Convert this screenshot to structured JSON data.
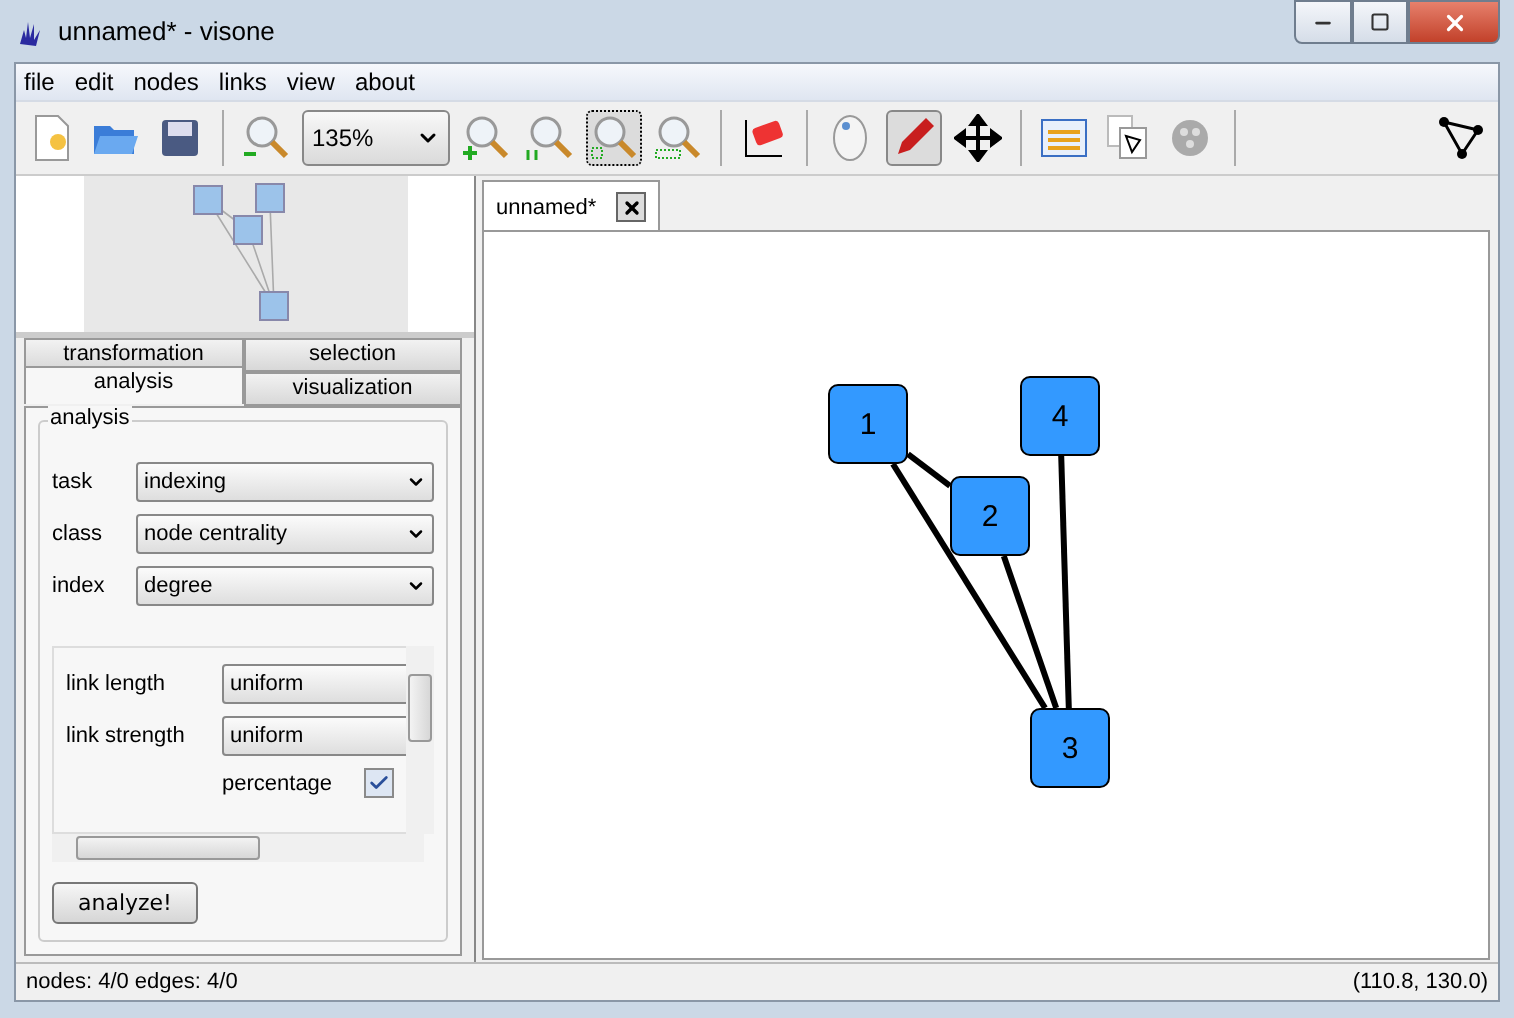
{
  "window": {
    "title": "unnamed* - visone"
  },
  "menu": [
    "file",
    "edit",
    "nodes",
    "links",
    "view",
    "about"
  ],
  "toolbar": [
    {
      "kind": "new",
      "selected": false
    },
    {
      "kind": "open",
      "selected": false
    },
    {
      "kind": "save",
      "selected": false
    },
    {
      "kind": "sep"
    },
    {
      "kind": "zoom-out",
      "selected": false
    },
    {
      "kind": "zoom-select",
      "value": "135%"
    },
    {
      "kind": "zoom-in",
      "selected": false
    },
    {
      "kind": "zoom-actual",
      "selected": false
    },
    {
      "kind": "zoom-fit",
      "selected": true
    },
    {
      "kind": "zoom-width",
      "selected": false
    },
    {
      "kind": "sep"
    },
    {
      "kind": "eraser",
      "selected": false
    },
    {
      "kind": "sep"
    },
    {
      "kind": "mouse",
      "selected": false
    },
    {
      "kind": "pencil",
      "selected": true
    },
    {
      "kind": "move",
      "selected": false
    },
    {
      "kind": "sep"
    },
    {
      "kind": "list",
      "selected": false
    },
    {
      "kind": "copy",
      "selected": false
    },
    {
      "kind": "film",
      "selected": false
    },
    {
      "kind": "sep"
    },
    {
      "kind": "spacer"
    },
    {
      "kind": "graph",
      "selected": false
    }
  ],
  "side_tabs": [
    [
      {
        "label": "transformation",
        "selected": false
      },
      {
        "label": "selection",
        "selected": false
      }
    ],
    [
      {
        "label": "analysis",
        "selected": true
      },
      {
        "label": "visualization",
        "selected": false
      }
    ]
  ],
  "analysis": {
    "legend": "analysis",
    "fields": [
      {
        "label": "task",
        "value": "indexing"
      },
      {
        "label": "class",
        "value": "node centrality"
      },
      {
        "label": "index",
        "value": "degree"
      }
    ],
    "options": [
      {
        "kind": "select",
        "label": "link length",
        "value": "uniform"
      },
      {
        "kind": "select",
        "label": "link strength",
        "value": "uniform"
      },
      {
        "kind": "checkbox",
        "label": "percentage",
        "checked": true
      }
    ],
    "button": "analyze!"
  },
  "document_tabs": [
    {
      "label": "unnamed*",
      "selected": true
    }
  ],
  "graph": {
    "nodes": [
      {
        "label": "1"
      },
      {
        "label": "2"
      },
      {
        "label": "3"
      },
      {
        "label": "4"
      }
    ]
  },
  "status_bar": {
    "counts": "nodes: 4/0 edges: 4/0",
    "coordinates": "(110.8, 130.0)"
  }
}
